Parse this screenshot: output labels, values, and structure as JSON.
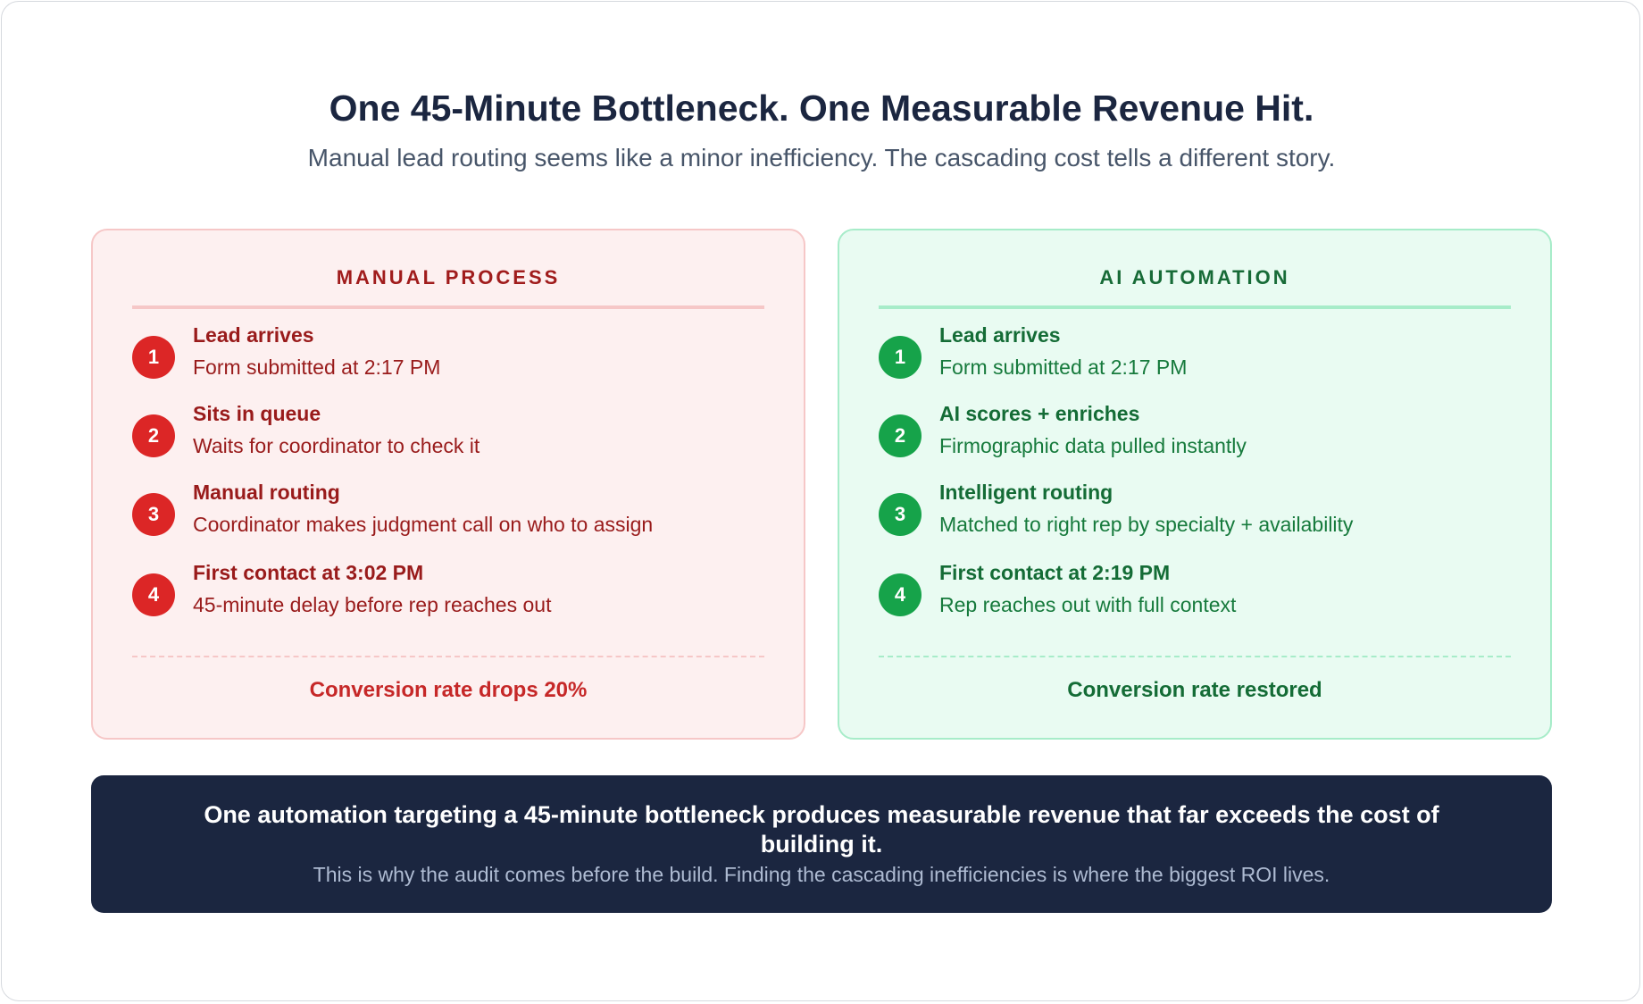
{
  "header": {
    "title": "One 45-Minute Bottleneck. One Measurable Revenue Hit.",
    "subtitle": "Manual lead routing seems like a minor inefficiency. The cascading cost tells a different story."
  },
  "manual": {
    "title": "MANUAL PROCESS",
    "accent": "#dc2626",
    "steps": [
      {
        "num": "1",
        "title": "Lead arrives",
        "desc": "Form submitted at 2:17 PM"
      },
      {
        "num": "2",
        "title": "Sits in queue",
        "desc": "Waits for coordinator to check it"
      },
      {
        "num": "3",
        "title": "Manual routing",
        "desc": "Coordinator makes judgment call on who to assign"
      },
      {
        "num": "4",
        "title": "First contact at 3:02 PM",
        "desc": "45-minute delay before rep reaches out"
      }
    ],
    "result": "Conversion rate drops 20%"
  },
  "ai": {
    "title": "AI AUTOMATION",
    "accent": "#16a34a",
    "steps": [
      {
        "num": "1",
        "title": "Lead arrives",
        "desc": "Form submitted at 2:17 PM"
      },
      {
        "num": "2",
        "title": "AI scores + enriches",
        "desc": "Firmographic data pulled instantly"
      },
      {
        "num": "3",
        "title": "Intelligent routing",
        "desc": "Matched to right rep by specialty + availability"
      },
      {
        "num": "4",
        "title": "First contact at 2:19 PM",
        "desc": "Rep reaches out with full context"
      }
    ],
    "result": "Conversion rate restored"
  },
  "banner": {
    "main": "One automation targeting a 45-minute bottleneck produces measurable revenue that far exceeds the cost of building it.",
    "sub": "This is why the audit comes before the build. Finding the cascading inefficiencies is where the biggest ROI lives."
  }
}
